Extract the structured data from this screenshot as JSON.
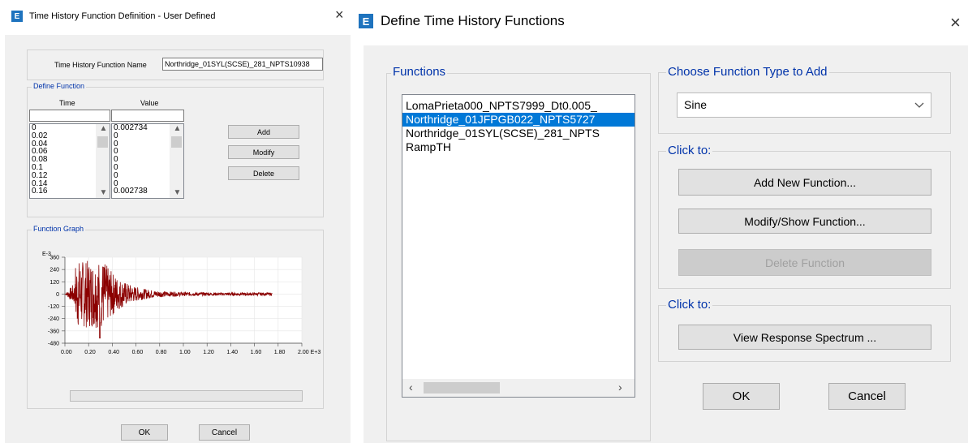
{
  "left_dialog": {
    "title": "Time History Function Definition  - User Defined",
    "close_glyph": "×",
    "function_name_label": "Time History Function Name",
    "function_name_value": "Northridge_01SYL(SCSE)_281_NPTS10938",
    "define_function_title": "Define Function",
    "time_header": "Time",
    "value_header": "Value",
    "time_values": [
      "0",
      "0.02",
      "0.04",
      "0.06",
      "0.08",
      "0.1",
      "0.12",
      "0.14",
      "0.16"
    ],
    "value_values": [
      "0.002734",
      "0",
      "0",
      "0",
      "0",
      "0",
      "0",
      "0",
      "0.002738"
    ],
    "add_button": "Add",
    "modify_button": "Modify",
    "delete_button": "Delete",
    "function_graph_title": "Function Graph",
    "graph": {
      "y_exponent": "E-3",
      "y_ticks": [
        "360",
        "240",
        "120",
        "0",
        "-120",
        "-240",
        "-360",
        "-480"
      ],
      "x_ticks": [
        "0.00",
        "0.20",
        "0.40",
        "0.60",
        "0.80",
        "1.00",
        "1.20",
        "1.40",
        "1.60",
        "1.80",
        "2.00 E+3"
      ],
      "line_color": "#8b0000"
    },
    "ok_button": "OK",
    "cancel_button": "Cancel"
  },
  "right_dialog": {
    "title": "Define Time History Functions",
    "close_glyph": "×",
    "functions_title": "Functions",
    "functions": [
      {
        "name": "LomaPrieta000_NPTS7999_Dt0.005_",
        "selected": false
      },
      {
        "name": "Northridge_01JFPGB022_NPTS5727",
        "selected": true
      },
      {
        "name": "Northridge_01SYL(SCSE)_281_NPTS",
        "selected": false
      },
      {
        "name": "RampTH",
        "selected": false
      }
    ],
    "choose_type_title": "Choose  Function Type to Add",
    "function_type_selected": "Sine",
    "click_to_label_1": "Click to:",
    "add_new_button": "Add New Function...",
    "modify_show_button": "Modify/Show Function...",
    "delete_function_button": "Delete Function",
    "click_to_label_2": "Click to:",
    "view_response_button": "View Response Spectrum ...",
    "ok_button": "OK",
    "cancel_button": "Cancel"
  },
  "colors": {
    "dialog_bg": "#f0f0f0",
    "selection": "#0078d7",
    "app_icon": "#1e73be"
  }
}
